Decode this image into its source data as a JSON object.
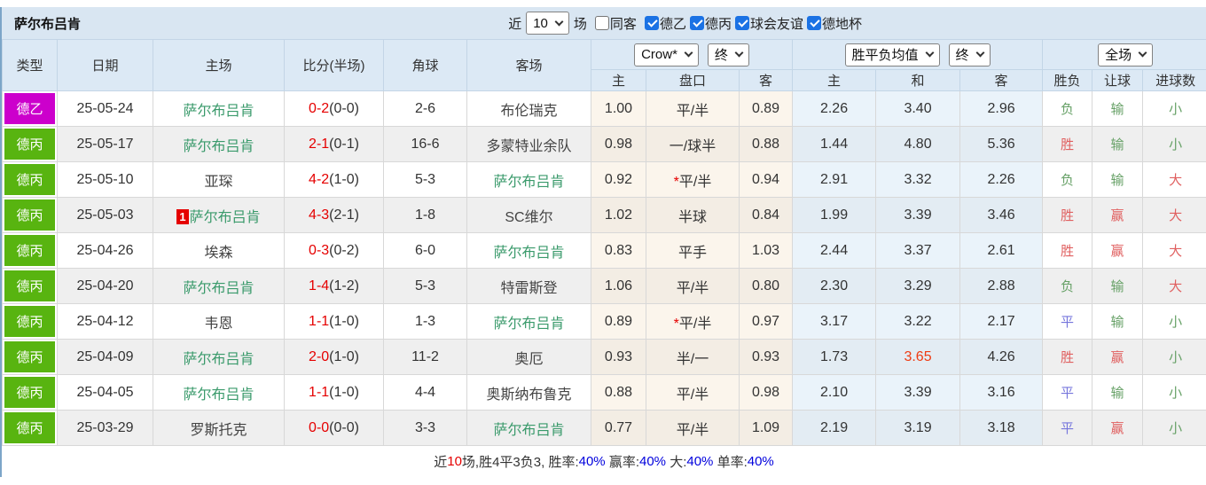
{
  "header": {
    "title": "萨尔布吕肯",
    "filter": {
      "recent_label": "近",
      "recent_value": "10",
      "matches_label": "场",
      "same_venue_label": "同客",
      "same_venue_checked": false,
      "leagues": [
        {
          "label": "德乙",
          "checked": true
        },
        {
          "label": "德丙",
          "checked": true
        },
        {
          "label": "球会友谊",
          "checked": true
        },
        {
          "label": "德地杯",
          "checked": true
        }
      ]
    }
  },
  "table": {
    "columns": [
      "类型",
      "日期",
      "主场",
      "比分(半场)",
      "角球",
      "客场"
    ],
    "sub_columns": [
      "主",
      "盘口",
      "客",
      "主",
      "和",
      "客",
      "胜负",
      "让球",
      "进球数"
    ],
    "selects": {
      "bookmaker": "Crow*",
      "asia_period": "终",
      "europe_metric": "胜平负均值",
      "europe_period": "终",
      "scope": "全场"
    },
    "rows": [
      {
        "league": "德乙",
        "date": "25-05-24",
        "home": "萨尔布吕肯",
        "home_focus": true,
        "home_badge": "",
        "away": "布伦瑞克",
        "away_focus": false,
        "score": "0-2",
        "half": "(0-0)",
        "corner": "2-6",
        "asia": {
          "home": "1.00",
          "star": false,
          "line": "平/半",
          "away": "0.89"
        },
        "europe": {
          "home": "2.26",
          "draw": "3.40",
          "draw_hot": false,
          "away": "2.96"
        },
        "outcome": {
          "result": "负",
          "handicap": "输",
          "goals": "小"
        }
      },
      {
        "league": "德丙",
        "date": "25-05-17",
        "home": "萨尔布吕肯",
        "home_focus": true,
        "home_badge": "",
        "away": "多蒙特业余队",
        "away_focus": false,
        "score": "2-1",
        "half": "(0-1)",
        "corner": "16-6",
        "asia": {
          "home": "0.98",
          "star": false,
          "line": "一/球半",
          "away": "0.88"
        },
        "europe": {
          "home": "1.44",
          "draw": "4.80",
          "draw_hot": false,
          "away": "5.36"
        },
        "outcome": {
          "result": "胜",
          "handicap": "输",
          "goals": "小"
        }
      },
      {
        "league": "德丙",
        "date": "25-05-10",
        "home": "亚琛",
        "home_focus": false,
        "home_badge": "",
        "away": "萨尔布吕肯",
        "away_focus": true,
        "score": "4-2",
        "half": "(1-0)",
        "corner": "5-3",
        "asia": {
          "home": "0.92",
          "star": true,
          "line": "平/半",
          "away": "0.94"
        },
        "europe": {
          "home": "2.91",
          "draw": "3.32",
          "draw_hot": false,
          "away": "2.26"
        },
        "outcome": {
          "result": "负",
          "handicap": "输",
          "goals": "大"
        }
      },
      {
        "league": "德丙",
        "date": "25-05-03",
        "home": "萨尔布吕肯",
        "home_focus": true,
        "home_badge": "1",
        "away": "SC维尔",
        "away_focus": false,
        "score": "4-3",
        "half": "(2-1)",
        "corner": "1-8",
        "asia": {
          "home": "1.02",
          "star": false,
          "line": "半球",
          "away": "0.84"
        },
        "europe": {
          "home": "1.99",
          "draw": "3.39",
          "draw_hot": false,
          "away": "3.46"
        },
        "outcome": {
          "result": "胜",
          "handicap": "赢",
          "goals": "大"
        }
      },
      {
        "league": "德丙",
        "date": "25-04-26",
        "home": "埃森",
        "home_focus": false,
        "home_badge": "",
        "away": "萨尔布吕肯",
        "away_focus": true,
        "score": "0-3",
        "half": "(0-2)",
        "corner": "6-0",
        "asia": {
          "home": "0.83",
          "star": false,
          "line": "平手",
          "away": "1.03"
        },
        "europe": {
          "home": "2.44",
          "draw": "3.37",
          "draw_hot": false,
          "away": "2.61"
        },
        "outcome": {
          "result": "胜",
          "handicap": "赢",
          "goals": "大"
        }
      },
      {
        "league": "德丙",
        "date": "25-04-20",
        "home": "萨尔布吕肯",
        "home_focus": true,
        "home_badge": "",
        "away": "特雷斯登",
        "away_focus": false,
        "score": "1-4",
        "half": "(1-2)",
        "corner": "5-3",
        "asia": {
          "home": "1.06",
          "star": false,
          "line": "平/半",
          "away": "0.80"
        },
        "europe": {
          "home": "2.30",
          "draw": "3.29",
          "draw_hot": false,
          "away": "2.88"
        },
        "outcome": {
          "result": "负",
          "handicap": "输",
          "goals": "大"
        }
      },
      {
        "league": "德丙",
        "date": "25-04-12",
        "home": "韦恩",
        "home_focus": false,
        "home_badge": "",
        "away": "萨尔布吕肯",
        "away_focus": true,
        "score": "1-1",
        "half": "(1-0)",
        "corner": "1-3",
        "asia": {
          "home": "0.89",
          "star": true,
          "line": "平/半",
          "away": "0.97"
        },
        "europe": {
          "home": "3.17",
          "draw": "3.22",
          "draw_hot": false,
          "away": "2.17"
        },
        "outcome": {
          "result": "平",
          "handicap": "输",
          "goals": "小"
        }
      },
      {
        "league": "德丙",
        "date": "25-04-09",
        "home": "萨尔布吕肯",
        "home_focus": true,
        "home_badge": "",
        "away": "奥厄",
        "away_focus": false,
        "score": "2-0",
        "half": "(1-0)",
        "corner": "11-2",
        "asia": {
          "home": "0.93",
          "star": false,
          "line": "半/一",
          "away": "0.93"
        },
        "europe": {
          "home": "1.73",
          "draw": "3.65",
          "draw_hot": true,
          "away": "4.26"
        },
        "outcome": {
          "result": "胜",
          "handicap": "赢",
          "goals": "小"
        }
      },
      {
        "league": "德丙",
        "date": "25-04-05",
        "home": "萨尔布吕肯",
        "home_focus": true,
        "home_badge": "",
        "away": "奥斯纳布鲁克",
        "away_focus": false,
        "score": "1-1",
        "half": "(1-0)",
        "corner": "4-4",
        "asia": {
          "home": "0.88",
          "star": false,
          "line": "平/半",
          "away": "0.98"
        },
        "europe": {
          "home": "2.10",
          "draw": "3.39",
          "draw_hot": false,
          "away": "3.16"
        },
        "outcome": {
          "result": "平",
          "handicap": "输",
          "goals": "小"
        }
      },
      {
        "league": "德丙",
        "date": "25-03-29",
        "home": "罗斯托克",
        "home_focus": false,
        "home_badge": "",
        "away": "萨尔布吕肯",
        "away_focus": true,
        "score": "0-0",
        "half": "(0-0)",
        "corner": "3-3",
        "asia": {
          "home": "0.77",
          "star": false,
          "line": "平/半",
          "away": "1.09"
        },
        "europe": {
          "home": "2.19",
          "draw": "3.19",
          "draw_hot": false,
          "away": "3.18"
        },
        "outcome": {
          "result": "平",
          "handicap": "赢",
          "goals": "小"
        }
      }
    ]
  },
  "summary": {
    "segments": [
      {
        "text": "近",
        "color": "dark"
      },
      {
        "text": "10",
        "color": "red"
      },
      {
        "text": "场,胜4平3负3, 胜率:",
        "color": "dark"
      },
      {
        "text": "40%",
        "color": "blue"
      },
      {
        "text": " 赢率:",
        "color": "dark"
      },
      {
        "text": "40%",
        "color": "blue"
      },
      {
        "text": " 大:",
        "color": "dark"
      },
      {
        "text": "40%",
        "color": "blue"
      },
      {
        "text": " 单率:",
        "color": "dark"
      },
      {
        "text": "40%",
        "color": "blue"
      }
    ]
  },
  "colors": {
    "league": {
      "德乙": "#CC00CC",
      "德丙": "#58B410"
    },
    "focus_team": "#3A9A6B",
    "score_red": "#E50000",
    "hot_odds": "#EE3B12",
    "result": {
      "胜": "#E06060",
      "平": "#7676DC",
      "负": "#67A167"
    },
    "handicap": {
      "赢": "#E06060",
      "输": "#67A167"
    },
    "goals": {
      "大": "#E06060",
      "小": "#67A167"
    }
  }
}
